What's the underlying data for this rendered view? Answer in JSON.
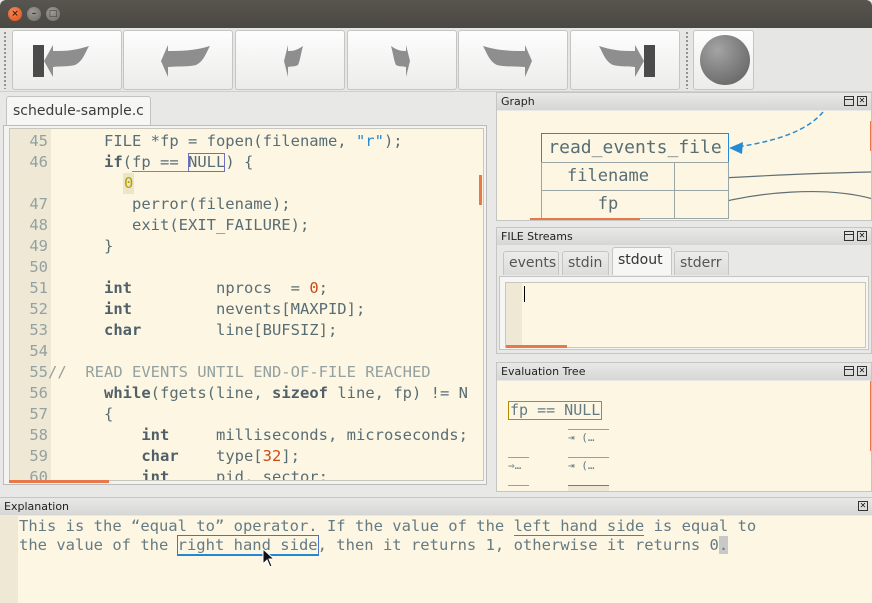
{
  "window": {
    "title": "",
    "controls": {
      "close": "×",
      "minimize": "–",
      "maximize": "□"
    }
  },
  "toolbar": {
    "buttons": [
      {
        "name": "step-back-to-start",
        "icon": "rewind-to-start-icon"
      },
      {
        "name": "step-back",
        "icon": "step-back-icon"
      },
      {
        "name": "step-back-small",
        "icon": "step-back-small-icon"
      },
      {
        "name": "step-forward-small",
        "icon": "step-forward-small-icon"
      },
      {
        "name": "step-forward",
        "icon": "step-forward-icon"
      },
      {
        "name": "step-forward-to-end",
        "icon": "forward-to-end-icon"
      }
    ],
    "stop_button": {
      "icon": "stop-ball-icon"
    }
  },
  "editor": {
    "tab_label": "schedule-sample.c",
    "lines": [
      {
        "n": "45",
        "parts": [
          [
            "    FILE *fp = fopen(filename, ",
            ""
          ],
          [
            "\"r\"",
            "str"
          ],
          [
            ");",
            ""
          ]
        ]
      },
      {
        "n": "46",
        "parts": [
          [
            "    ",
            ""
          ],
          [
            "if",
            "kw"
          ],
          [
            "(",
            ""
          ],
          [
            "fp == ",
            "hl-expr"
          ],
          [
            "NULL",
            "hl-expr hl-null"
          ],
          [
            ") {",
            ""
          ]
        ]
      },
      {
        "n": "",
        "parts": []
      },
      {
        "n": "47",
        "parts": [
          [
            "       perror(filename);",
            ""
          ]
        ]
      },
      {
        "n": "48",
        "parts": [
          [
            "       exit(EXIT_FAILURE);",
            ""
          ]
        ]
      },
      {
        "n": "49",
        "parts": [
          [
            "    }",
            ""
          ]
        ]
      },
      {
        "n": "50",
        "parts": []
      },
      {
        "n": "51",
        "parts": [
          [
            "    ",
            ""
          ],
          [
            "int",
            "kw"
          ],
          [
            "         nprocs  = ",
            ""
          ],
          [
            "0",
            "num"
          ],
          [
            ";",
            ""
          ]
        ]
      },
      {
        "n": "52",
        "parts": [
          [
            "    ",
            ""
          ],
          [
            "int",
            "kw"
          ],
          [
            "         nevents[MAXPID];",
            ""
          ]
        ]
      },
      {
        "n": "53",
        "parts": [
          [
            "    ",
            ""
          ],
          [
            "char",
            "kw"
          ],
          [
            "        line[BUFSIZ];",
            ""
          ]
        ]
      },
      {
        "n": "54",
        "parts": []
      },
      {
        "n": "55",
        "parts": [
          [
            "//  READ EVENTS UNTIL END-OF-FILE REACHED",
            "cm"
          ]
        ],
        "comment_flush": true
      },
      {
        "n": "56",
        "parts": [
          [
            "    ",
            ""
          ],
          [
            "while",
            "kw"
          ],
          [
            "(fgets(line, ",
            ""
          ],
          [
            "sizeof",
            "kw"
          ],
          [
            " line, fp) != N",
            ""
          ]
        ]
      },
      {
        "n": "57",
        "parts": [
          [
            "    {",
            ""
          ]
        ]
      },
      {
        "n": "58",
        "parts": [
          [
            "        ",
            ""
          ],
          [
            "int",
            "kw"
          ],
          [
            "     milliseconds, microseconds;",
            ""
          ]
        ]
      },
      {
        "n": "59",
        "parts": [
          [
            "        ",
            ""
          ],
          [
            "char",
            "kw"
          ],
          [
            "    type[",
            ""
          ],
          [
            "32",
            "num"
          ],
          [
            "];",
            ""
          ]
        ]
      },
      {
        "n": "60",
        "parts": [
          [
            "        ",
            ""
          ],
          [
            "int",
            "kw"
          ],
          [
            "     pid, sector;",
            ""
          ]
        ]
      }
    ],
    "inline_value": "0"
  },
  "graph_panel": {
    "title": "Graph",
    "frame": {
      "name": "read_events_file",
      "rows": [
        {
          "label": "filename",
          "value": ""
        },
        {
          "label": "fp",
          "value": ""
        }
      ]
    },
    "colors": {
      "arrow": "#268bd2",
      "edge": "#5f6f73"
    }
  },
  "streams_panel": {
    "title": "FILE Streams",
    "tabs": [
      "events",
      "stdin",
      "stdout",
      "stderr"
    ],
    "active_tab": "stdout",
    "content": ""
  },
  "eval_panel": {
    "title": "Evaluation Tree",
    "root": "fp == NULL",
    "children": [
      "⇥ (…",
      "⇥ (…",
      "⇒…"
    ]
  },
  "explanation_panel": {
    "title": "Explanation",
    "line1": [
      {
        "text": "This is the “equal to” operator. If the value of the ",
        "style": ""
      },
      {
        "text": "left hand side",
        "style": "link-u"
      },
      {
        "text": " is equal to",
        "style": ""
      }
    ],
    "line2": [
      {
        "text": "the value of the ",
        "style": ""
      },
      {
        "text": "right hand side",
        "style": "link-u link-box"
      },
      {
        "text": ", then it returns 1, otherwise it returns 0",
        "style": ""
      },
      {
        "text": ".",
        "style": "dotsel"
      }
    ]
  },
  "colors": {
    "editor_bg": "#fdf6e3",
    "gutter_bg": "#eee8d5",
    "accent_orange": "#e8784a",
    "highlight_expr": "#b58900",
    "highlight_operand": "#6c71c4"
  }
}
